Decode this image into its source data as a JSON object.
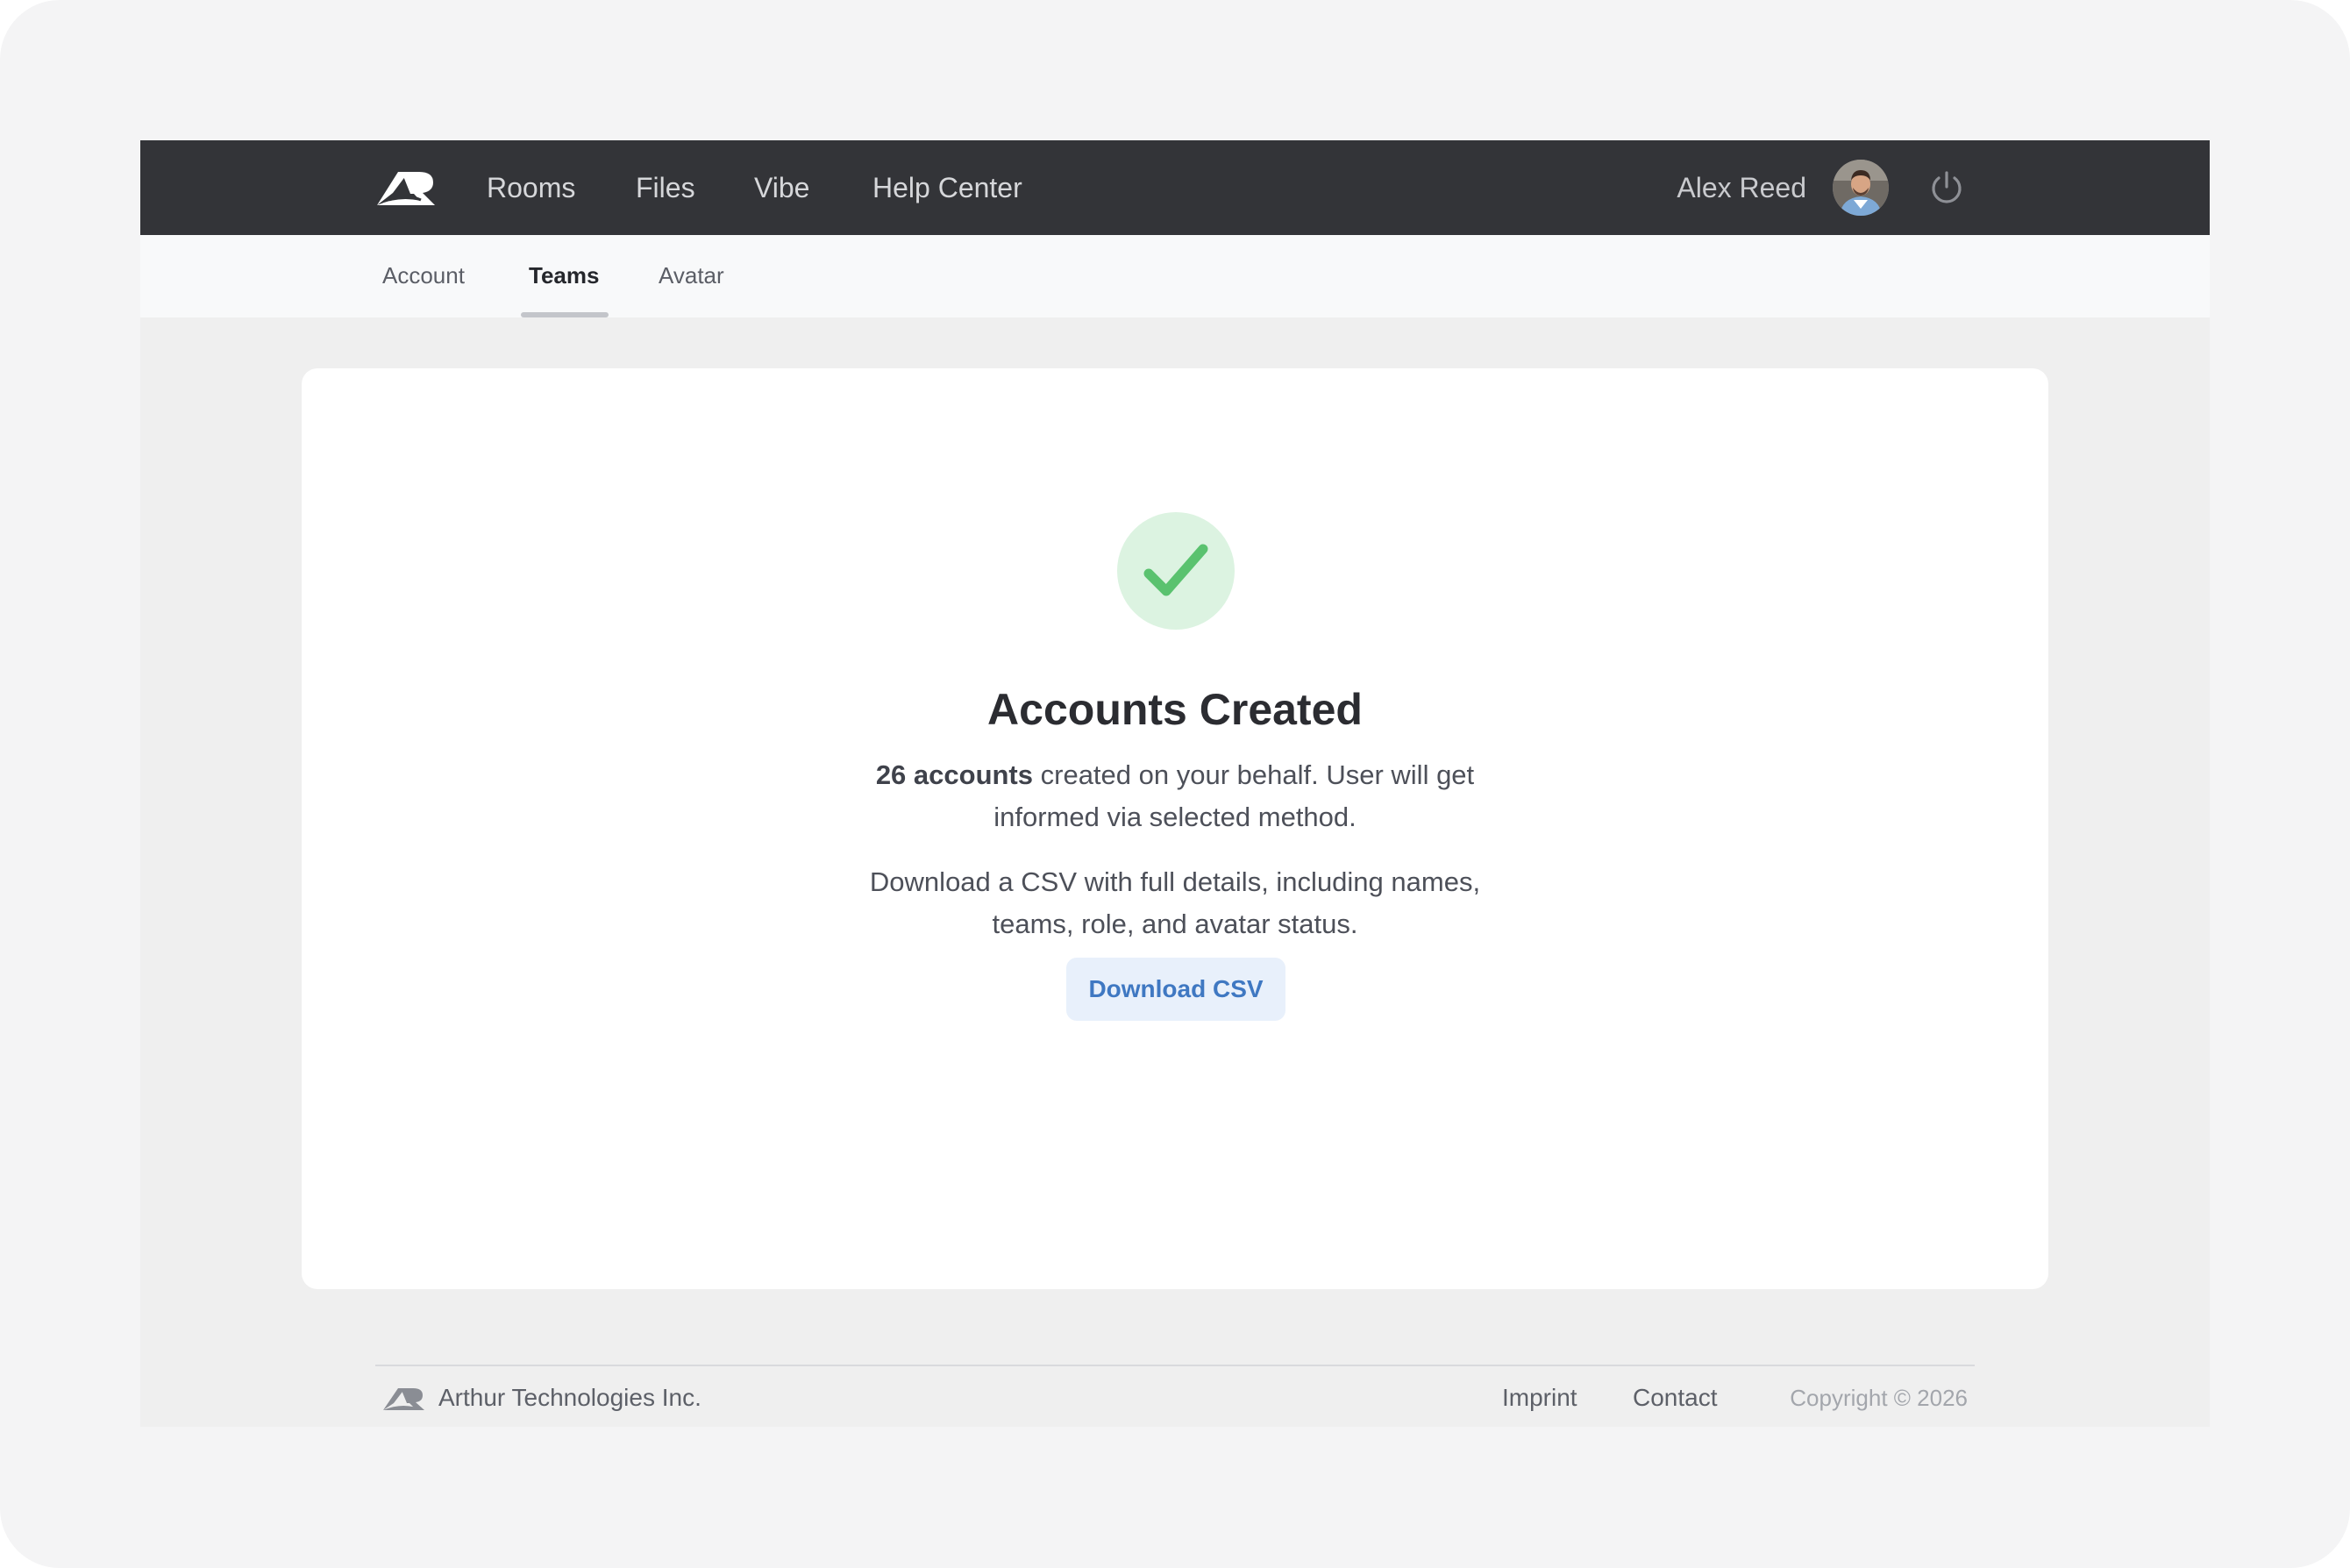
{
  "nav": {
    "items": [
      {
        "label": "Rooms"
      },
      {
        "label": "Files"
      },
      {
        "label": "Vibe"
      },
      {
        "label": "Help Center"
      }
    ],
    "user_name": "Alex Reed",
    "logo_icon": "arthur-logo-icon",
    "power_icon": "power-icon"
  },
  "subtabs": [
    {
      "label": "Account",
      "active": false
    },
    {
      "label": "Teams",
      "active": true
    },
    {
      "label": "Avatar",
      "active": false
    }
  ],
  "card": {
    "title": "Accounts Created",
    "count_label": "26 accounts",
    "message_rest": " created on your behalf. User will get informed via selected method.",
    "csv_message": "Download a CSV with full details, including names, teams, role, and avatar status.",
    "button_label": "Download CSV",
    "success_icon": "check-icon"
  },
  "footer": {
    "company": "Arthur Technologies Inc.",
    "links": [
      {
        "label": "Imprint"
      },
      {
        "label": "Contact"
      }
    ],
    "copyright": "Copyright © 2026"
  },
  "colors": {
    "topbar": "#333438",
    "accent": "#3f78c2",
    "success": "#5ac26f",
    "success_bg": "#dcf3e1"
  }
}
